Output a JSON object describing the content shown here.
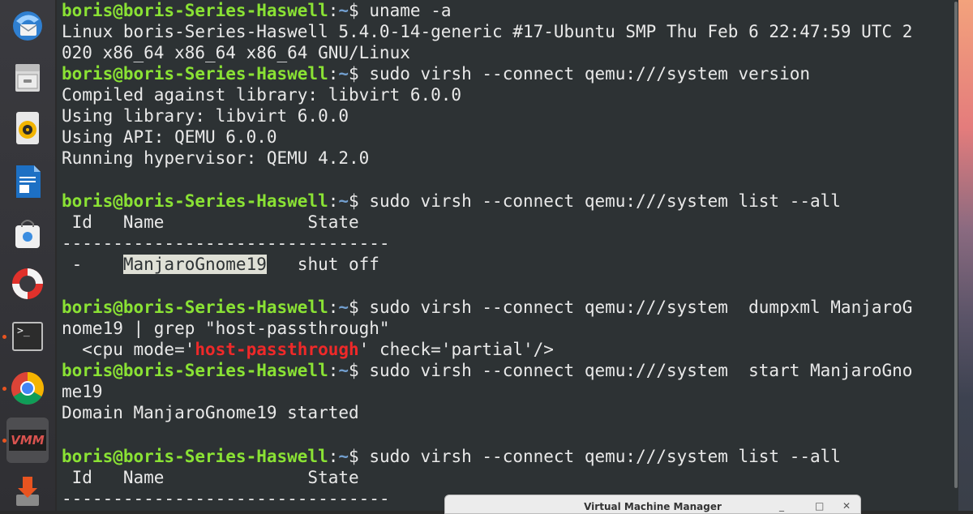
{
  "dock": {
    "items": [
      {
        "name": "thunderbird",
        "icon": "mail-icon"
      },
      {
        "name": "files",
        "icon": "file-cabinet-icon"
      },
      {
        "name": "rhythmbox",
        "icon": "speaker-icon"
      },
      {
        "name": "writer",
        "icon": "document-icon"
      },
      {
        "name": "software",
        "icon": "shopping-bag-icon"
      },
      {
        "name": "help",
        "icon": "lifebuoy-icon"
      },
      {
        "name": "terminal",
        "icon": "terminal-icon",
        "running": true
      },
      {
        "name": "chrome",
        "icon": "chrome-icon",
        "running": true
      },
      {
        "name": "virt-manager",
        "icon": "vmm-icon",
        "running": true,
        "active": true
      },
      {
        "name": "installer",
        "icon": "install-icon"
      }
    ],
    "terminal_icon_text": ">_",
    "vmm_icon_text": "VMM"
  },
  "terminal": {
    "user": "boris@boris-Series-Haswell",
    "sep": ":",
    "path": "~",
    "dollar": "$ ",
    "cmd1": "uname -a",
    "out1a": "Linux boris-Series-Haswell 5.4.0-14-generic #17-Ubuntu SMP Thu Feb 6 22:47:59 UTC 2",
    "out1b": "020 x86_64 x86_64 x86_64 GNU/Linux",
    "cmd2": "sudo virsh --connect qemu:///system version",
    "out2a": "Compiled against library: libvirt 6.0.0",
    "out2b": "Using library: libvirt 6.0.0",
    "out2c": "Using API: QEMU 6.0.0",
    "out2d": "Running hypervisor: QEMU 4.2.0",
    "cmd3": "sudo virsh --connect qemu:///system list --all",
    "table_header": " Id   Name              State",
    "table_rule": "--------------------------------",
    "row_pre": " -    ",
    "row_name": "ManjaroGnome19",
    "row_post": "   shut off",
    "cmd4a": "sudo virsh --connect qemu:///system  dumpxml ManjaroG",
    "cmd4b": "nome19 | grep \"host-passthrough\"",
    "xml_pre": "  <cpu mode='",
    "xml_hl": "host-passthrough",
    "xml_post": "' check='partial'/>",
    "cmd5a": "sudo virsh --connect qemu:///system  start ManjaroGno",
    "cmd5b": "me19",
    "out5": "Domain ManjaroGnome19 started",
    "cmd6": "sudo virsh --connect qemu:///system list --all",
    "table2_header": " Id   Name              State",
    "table2_rule": "--------------------------------"
  },
  "vmm_window": {
    "title": "Virtual Machine Manager",
    "minimize": "_",
    "maximize": "□",
    "close": "✕"
  }
}
